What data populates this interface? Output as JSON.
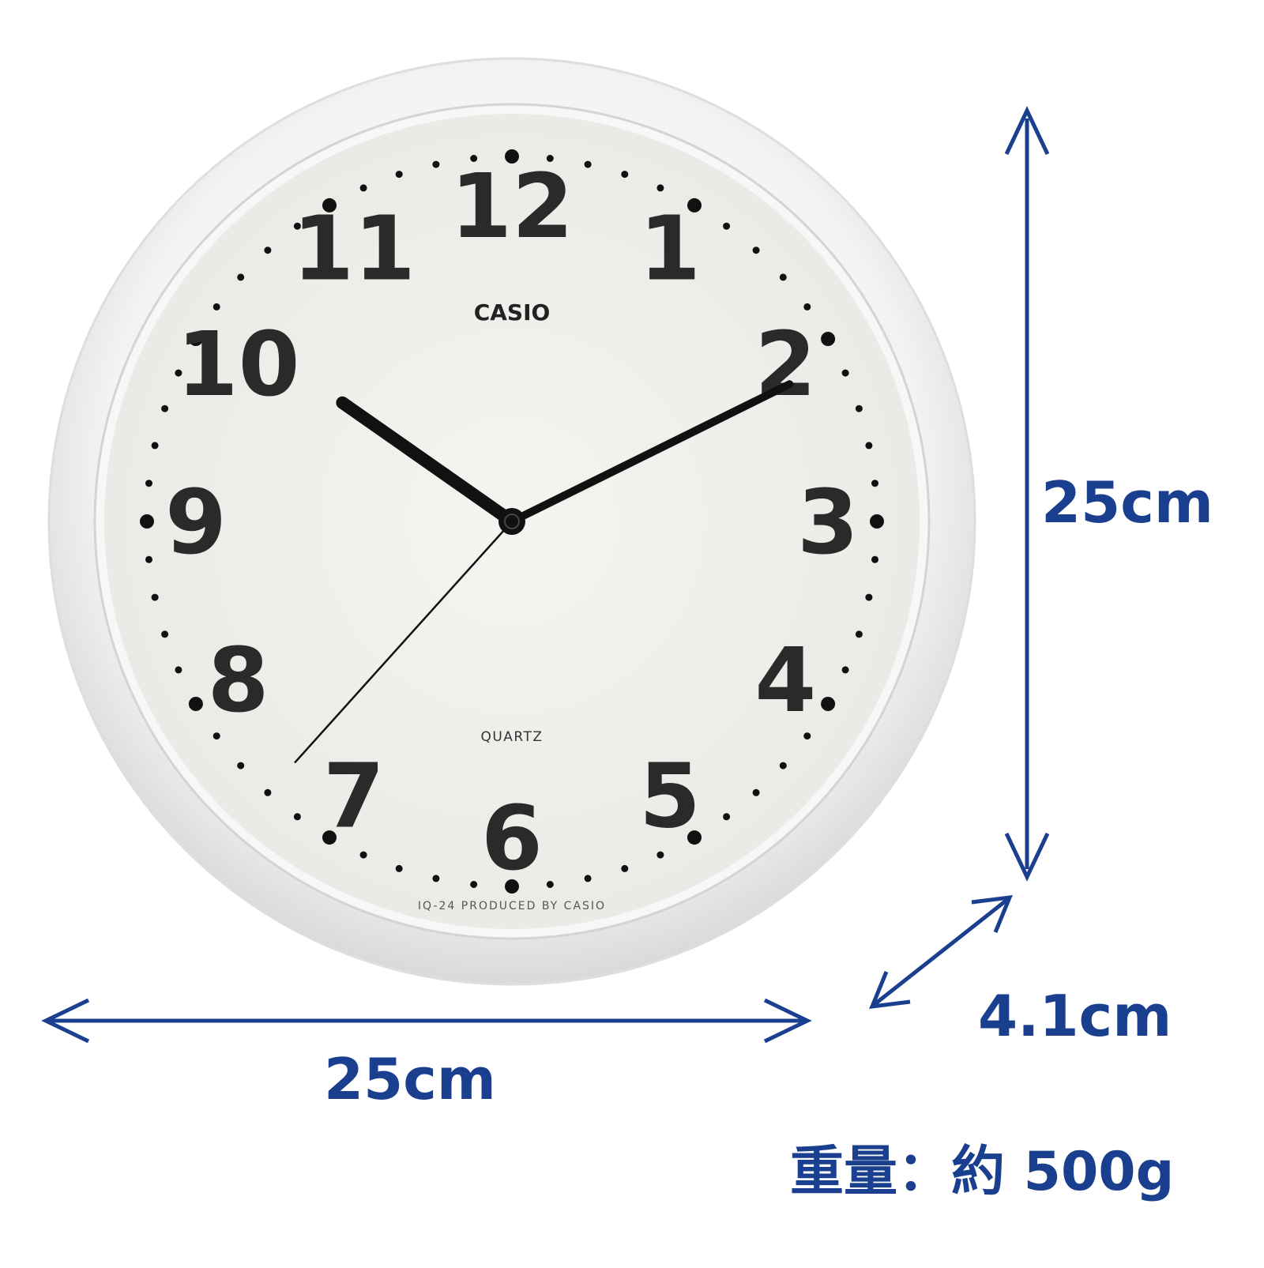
{
  "clock": {
    "brand": "CASIO",
    "movement": "QUARTZ",
    "model_line": "IQ-24  PRODUCED BY CASIO",
    "numerals": [
      "12",
      "1",
      "2",
      "3",
      "4",
      "5",
      "6",
      "7",
      "8",
      "9",
      "10",
      "11"
    ],
    "time": {
      "hour": 10,
      "minute": 10,
      "second": 37
    },
    "colors": {
      "case": "#f4f4f4",
      "dial": "#eeeeea",
      "ink": "#111111"
    }
  },
  "dimensions": {
    "height": "25cm",
    "width": "25cm",
    "depth": "4.1cm",
    "weight": "重量：約 500g",
    "color": "#1a3f8f"
  }
}
